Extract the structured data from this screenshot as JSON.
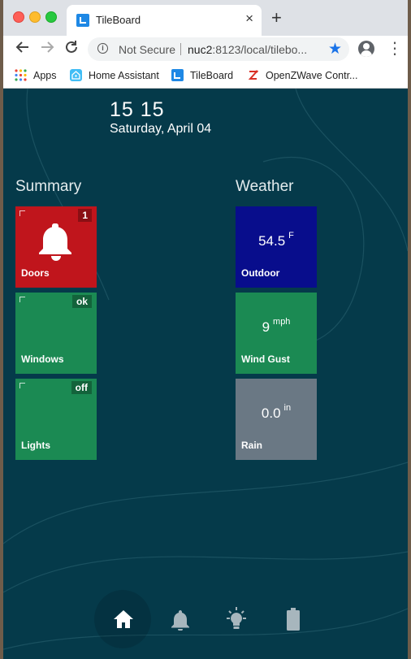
{
  "browser": {
    "tab_title": "TileBoard",
    "tab_close": "×",
    "new_tab": "+",
    "security_label": "Not Secure",
    "url_host": "nuc2",
    "url_rest": ":8123/local/tilebo...",
    "bookmarks": [
      {
        "label": "Apps",
        "icon": "apps-grid-icon"
      },
      {
        "label": "Home Assistant",
        "icon": "home-assistant-icon"
      },
      {
        "label": "TileBoard",
        "icon": "tileboard-icon"
      },
      {
        "label": "OpenZWave Contr...",
        "icon": "openzwave-icon"
      }
    ]
  },
  "header": {
    "time": "15 15",
    "date": "Saturday, April 04"
  },
  "groups": {
    "summary": {
      "title": "Summary",
      "tiles": [
        {
          "label": "Doors",
          "badge": "1",
          "color": "#c0151c",
          "icon": "bell-icon"
        },
        {
          "label": "Windows",
          "badge": "ok",
          "color": "#1b8a53"
        },
        {
          "label": "Lights",
          "badge": "off",
          "color": "#1b8a53"
        }
      ]
    },
    "weather": {
      "title": "Weather",
      "tiles": [
        {
          "label": "Outdoor",
          "value": "54.5",
          "unit": "F",
          "color": "#080d8c"
        },
        {
          "label": "Wind Gust",
          "value": "9",
          "unit": "mph",
          "color": "#1b8a53"
        },
        {
          "label": "Rain",
          "value": "0.0",
          "unit": "in",
          "color": "#6a7884"
        }
      ]
    }
  },
  "footer_nav": {
    "items": [
      {
        "name": "home",
        "icon": "home-icon",
        "active": true
      },
      {
        "name": "alerts",
        "icon": "bell-icon",
        "active": false
      },
      {
        "name": "lights",
        "icon": "lightbulb-icon",
        "active": false
      },
      {
        "name": "battery",
        "icon": "battery-icon",
        "active": false
      }
    ]
  },
  "colors": {
    "background": "#053a4a",
    "accent": "#1a73e8"
  }
}
